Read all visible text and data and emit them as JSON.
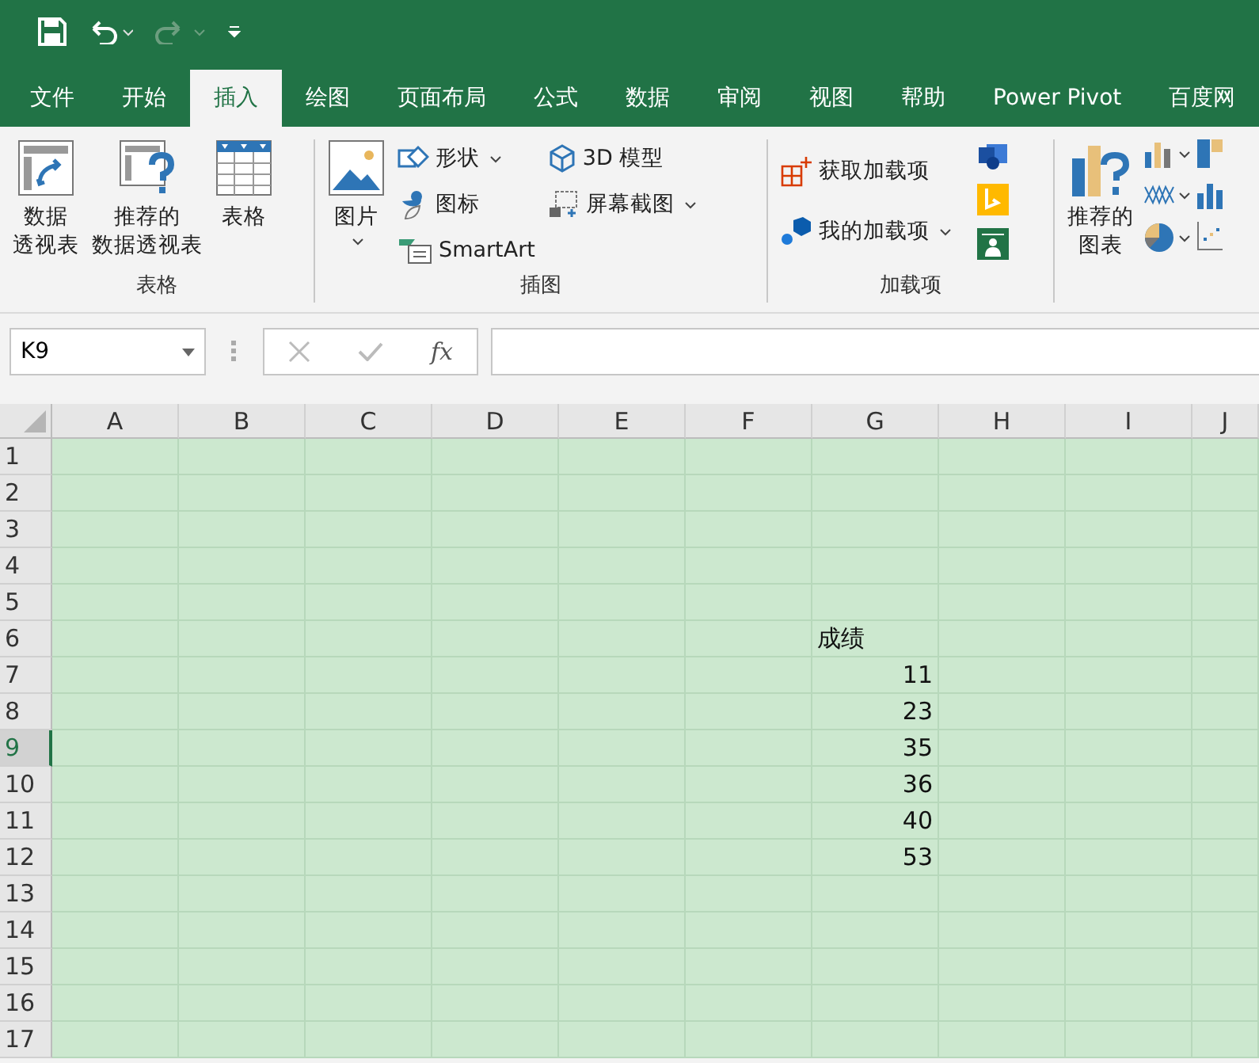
{
  "tabs": [
    {
      "label": "文件",
      "selected": false
    },
    {
      "label": "开始",
      "selected": false
    },
    {
      "label": "插入",
      "selected": true
    },
    {
      "label": "绘图",
      "selected": false
    },
    {
      "label": "页面布局",
      "selected": false
    },
    {
      "label": "公式",
      "selected": false
    },
    {
      "label": "数据",
      "selected": false
    },
    {
      "label": "审阅",
      "selected": false
    },
    {
      "label": "视图",
      "selected": false
    },
    {
      "label": "帮助",
      "selected": false
    },
    {
      "label": "Power Pivot",
      "selected": false
    },
    {
      "label": "百度网",
      "selected": false
    }
  ],
  "ribbon": {
    "tables_group": {
      "label": "表格",
      "buttons": [
        {
          "kind": "pivot",
          "label_lines": [
            "数据",
            "透视表"
          ]
        },
        {
          "kind": "recommended-pivot",
          "label_lines": [
            "推荐的",
            "数据透视表"
          ]
        },
        {
          "kind": "table",
          "label_lines": [
            "表格"
          ]
        }
      ]
    },
    "illustrations_group": {
      "label": "插图",
      "picture": {
        "label": "图片"
      },
      "items": [
        {
          "kind": "shapes",
          "label": "形状",
          "dropdown": true
        },
        {
          "kind": "icons",
          "label": "图标",
          "dropdown": false
        },
        {
          "kind": "smartart",
          "label": "SmartArt",
          "dropdown": false
        }
      ],
      "items_2": [
        {
          "kind": "model3d",
          "label": "3D 模型",
          "dropdown": false
        },
        {
          "kind": "screenshot",
          "label": "屏幕截图",
          "dropdown": true
        }
      ]
    },
    "addins_group": {
      "label": "加载项",
      "items": [
        {
          "kind": "get",
          "label": "获取加载项",
          "dropdown": false
        },
        {
          "kind": "my",
          "label": "我的加载项",
          "dropdown": true
        }
      ]
    },
    "charts_group": {
      "recommended": {
        "label_lines": [
          "推荐的",
          "图表"
        ]
      }
    }
  },
  "formula_bar": {
    "name_box": "K9",
    "function_label": "fx"
  },
  "sheet": {
    "columns": [
      "A",
      "B",
      "C",
      "D",
      "E",
      "F",
      "G",
      "H",
      "I",
      "J"
    ],
    "rows": [
      {
        "label": "1",
        "selected": false
      },
      {
        "label": "2",
        "selected": false
      },
      {
        "label": "3",
        "selected": false
      },
      {
        "label": "4",
        "selected": false
      },
      {
        "label": "5",
        "selected": false
      },
      {
        "label": "6",
        "selected": false,
        "cell_g": {
          "text": "成绩",
          "kind": "text"
        }
      },
      {
        "label": "7",
        "selected": false,
        "cell_g": {
          "text": "11",
          "kind": "number"
        }
      },
      {
        "label": "8",
        "selected": false,
        "cell_g": {
          "text": "23",
          "kind": "number"
        }
      },
      {
        "label": "9",
        "selected": true,
        "cell_g": {
          "text": "35",
          "kind": "number"
        }
      },
      {
        "label": "10",
        "selected": false,
        "cell_g": {
          "text": "36",
          "kind": "number"
        }
      },
      {
        "label": "11",
        "selected": false,
        "cell_g": {
          "text": "40",
          "kind": "number"
        }
      },
      {
        "label": "12",
        "selected": false,
        "cell_g": {
          "text": "53",
          "kind": "number"
        }
      },
      {
        "label": "13",
        "selected": false
      },
      {
        "label": "14",
        "selected": false
      },
      {
        "label": "15",
        "selected": false
      },
      {
        "label": "16",
        "selected": false
      },
      {
        "label": "17",
        "selected": false
      }
    ]
  }
}
